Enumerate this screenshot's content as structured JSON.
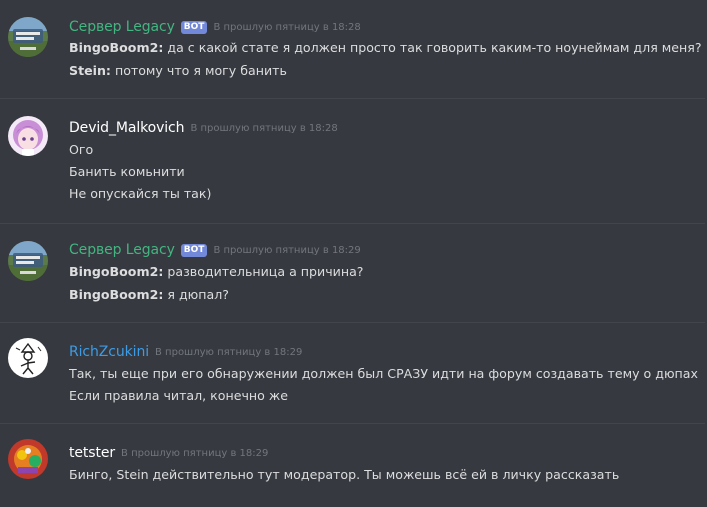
{
  "colors": {
    "background": "#36393f",
    "divider": "#42454a",
    "text": "#dcddde",
    "timestamp": "#72767d",
    "bot_tag": "#7289da",
    "username_green": "#43b581",
    "username_blue": "#3e9ce6",
    "username_white": "#ffffff"
  },
  "messages": [
    {
      "username": "Сервер Legacy",
      "bot_tag": "BOT",
      "timestamp": "В прошлую пятницу в 18:28",
      "avatar_icon": "legacy-server-icon",
      "lines": [
        {
          "author": "BingoBoom2:",
          "text": " да с какой стате я должен просто так говорить каким-то ноунеймам для меня?"
        },
        {
          "author": "Stein:",
          "text": " потому что я могу банить"
        }
      ]
    },
    {
      "username": "Devid_Malkovich",
      "timestamp": "В прошлую пятницу в 18:28",
      "avatar_icon": "anime-girl-avatar-icon",
      "lines": [
        {
          "text": "Ого"
        },
        {
          "text": "Банить комьнити"
        },
        {
          "text": "Не опускайся ты так)"
        }
      ]
    },
    {
      "username": "Сервер Legacy",
      "bot_tag": "BOT",
      "timestamp": "В прошлую пятницу в 18:29",
      "avatar_icon": "legacy-server-icon",
      "lines": [
        {
          "author": "BingoBoom2:",
          "text": " разводительница а причина?"
        },
        {
          "author": "BingoBoom2:",
          "text": " я дюпал?"
        }
      ]
    },
    {
      "username": "RichZcukini",
      "timestamp": "В прошлую пятницу в 18:29",
      "avatar_icon": "sketch-figure-avatar-icon",
      "lines": [
        {
          "text": "Так, ты еще при его обнаружении должен был СРАЗУ идти на форум создавать тему о дюпах"
        },
        {
          "text": "Если правила читал, конечно же"
        }
      ]
    },
    {
      "username": "tetster",
      "timestamp": "В прошлую пятницу в 18:29",
      "avatar_icon": "colorful-cartoon-avatar-icon",
      "lines": [
        {
          "text": "Бинго, Stein действительно тут модератор. Ты можешь всё ей в личку рассказать"
        }
      ]
    }
  ]
}
